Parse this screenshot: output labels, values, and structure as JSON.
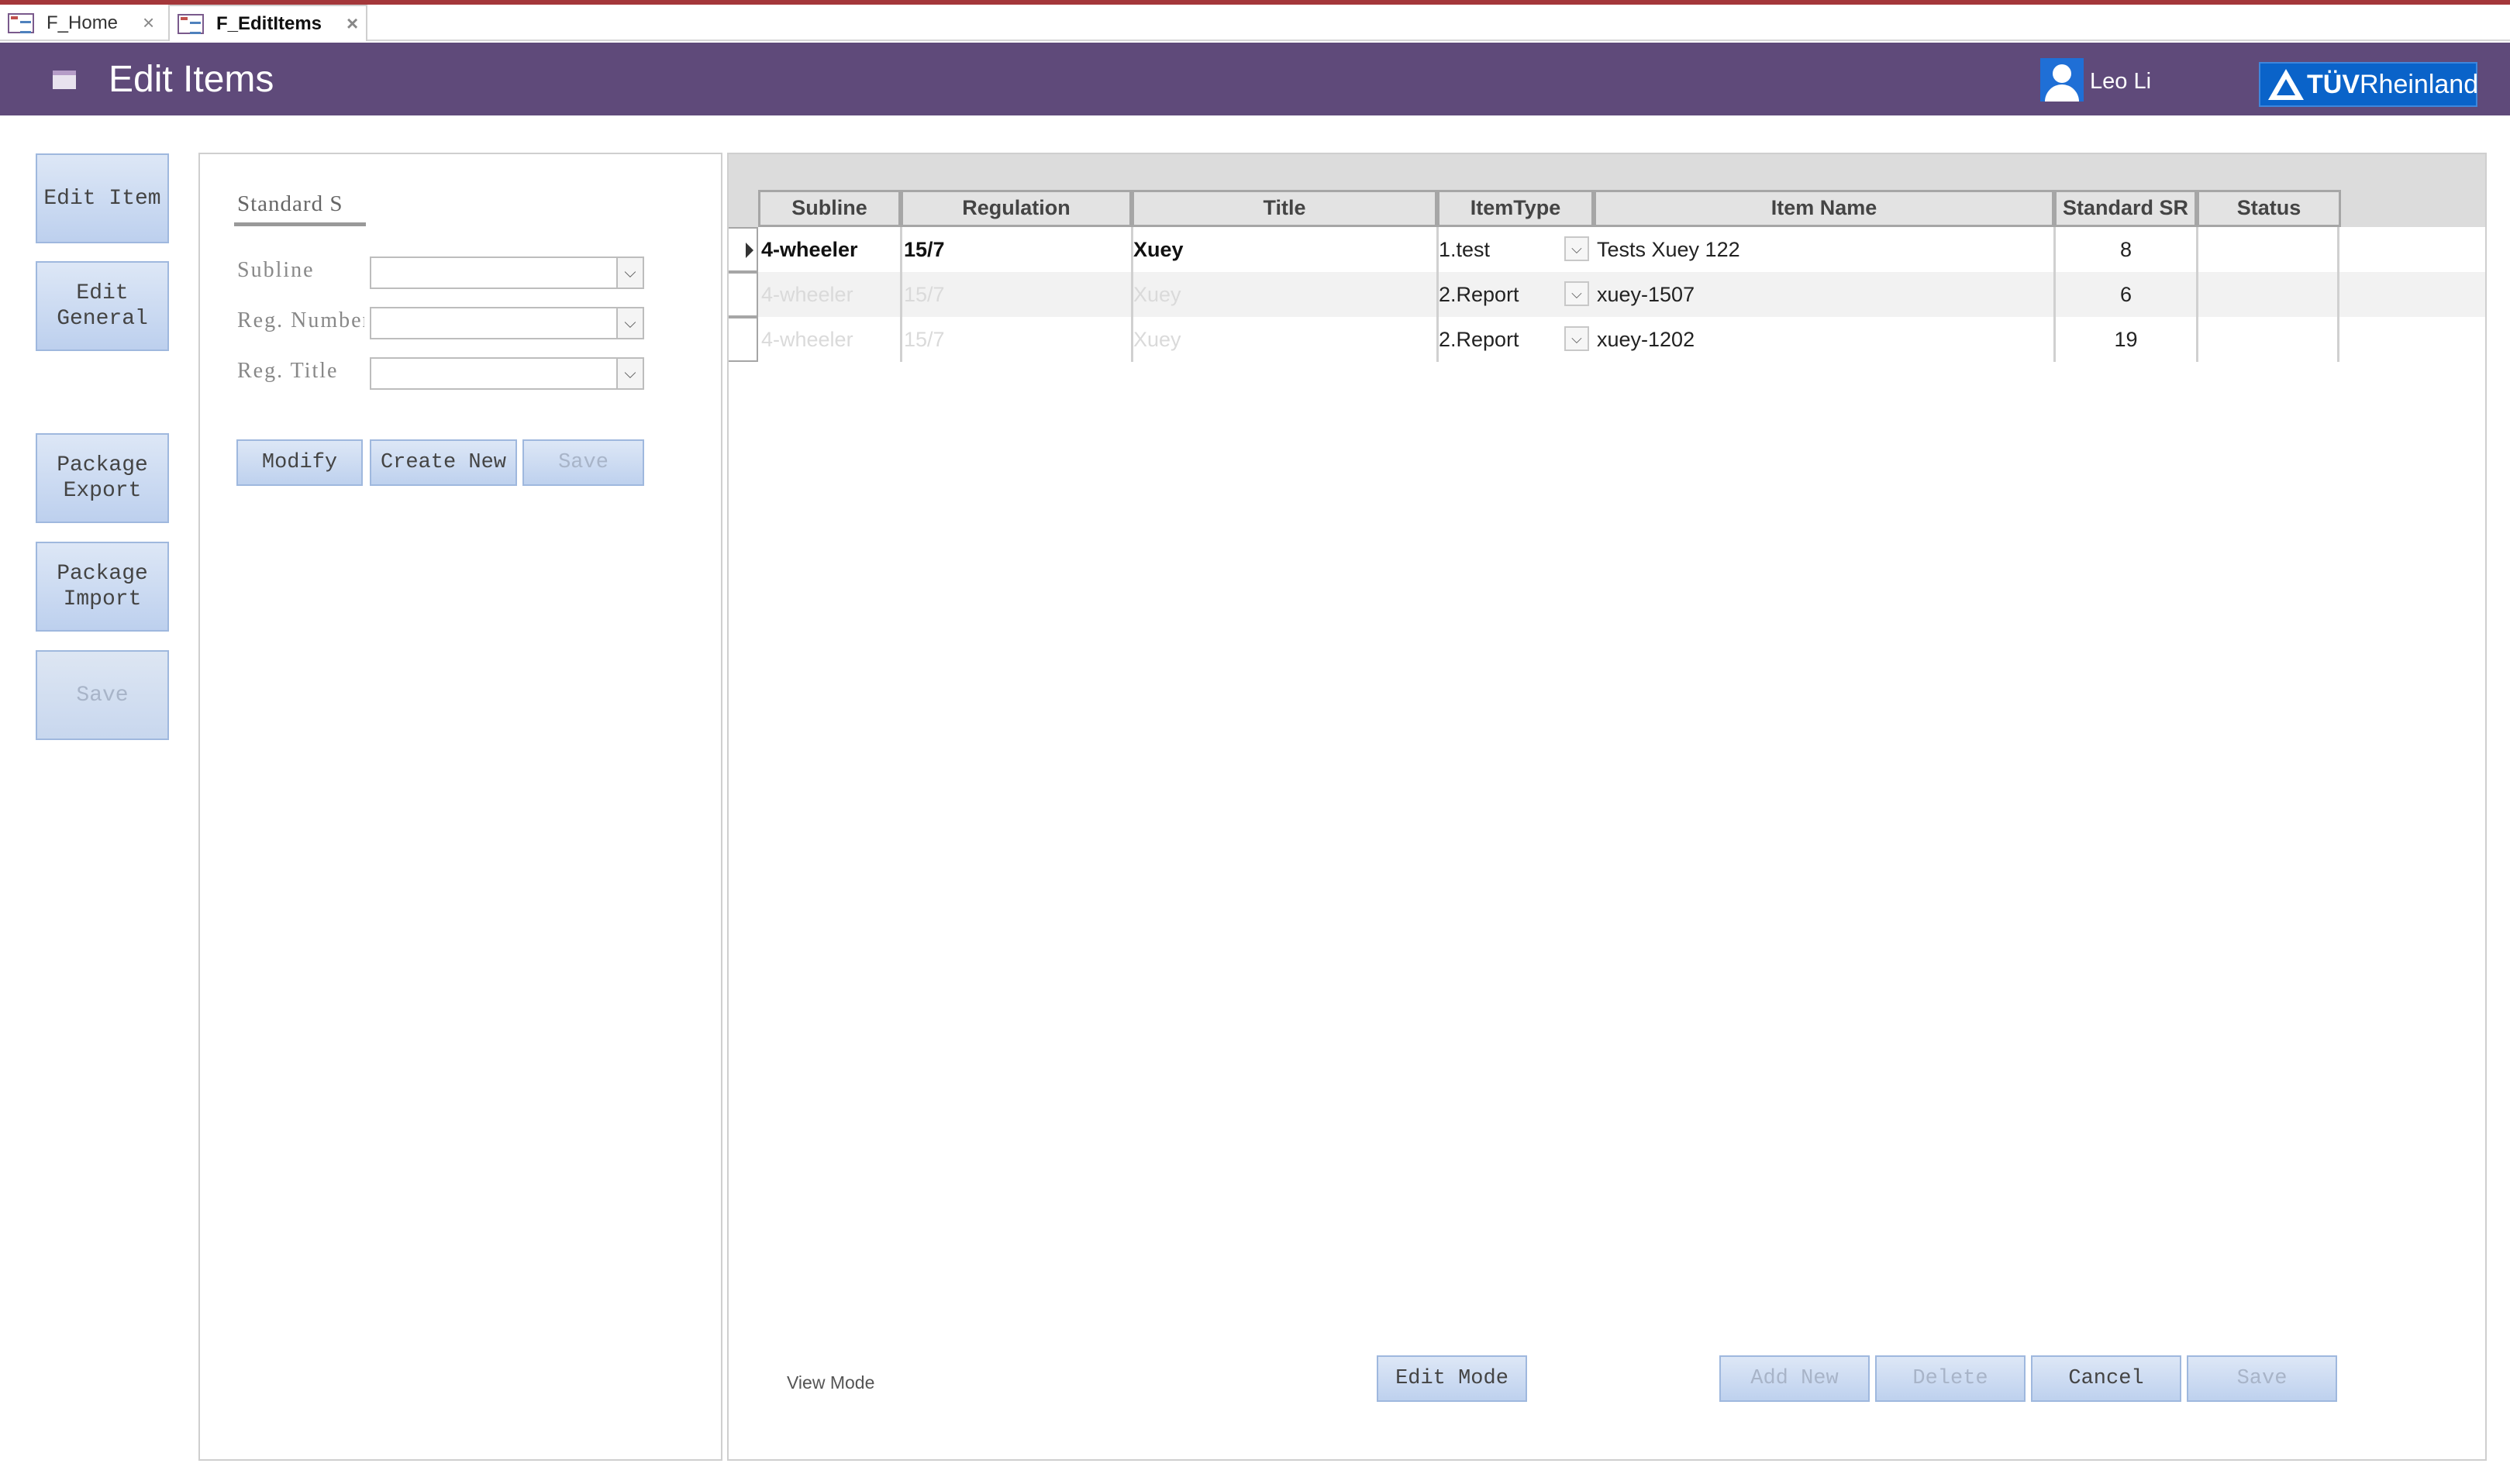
{
  "tabs": [
    {
      "label": "F_Home"
    },
    {
      "label": "F_EditItems"
    }
  ],
  "header": {
    "title": "Edit Items",
    "user_name": "Leo Li",
    "logo_tuv": "TÜV",
    "logo_rheinland": "Rheinland",
    "bg_color": "#5f4a7a"
  },
  "nav": {
    "edit_item": "Edit Item",
    "edit_general": "Edit\nGeneral",
    "package_export": "Package\nExport",
    "package_import": "Package\nImport",
    "save": "Save"
  },
  "filter": {
    "heading": "Standard S",
    "subline_label": "Subline",
    "subline_value": "",
    "reg_number_label": "Reg. Number",
    "reg_number_value": "",
    "reg_title_label": "Reg. Title",
    "reg_title_value": "",
    "modify": "Modify",
    "create_new": "Create New",
    "save": "Save"
  },
  "grid": {
    "columns": [
      "Subline",
      "Regulation",
      "Title",
      "ItemType",
      "Item Name",
      "Standard SR",
      "Status"
    ],
    "rows": [
      {
        "subline": "4-wheeler",
        "regulation": "15/7",
        "title": "Xuey",
        "item_type": "1.test",
        "item_name": "Tests Xuey 122",
        "standard_sr": "8",
        "status": ""
      },
      {
        "subline": "4-wheeler",
        "regulation": "15/7",
        "title": "Xuey",
        "item_type": "2.Report",
        "item_name": "xuey-1507",
        "standard_sr": "6",
        "status": ""
      },
      {
        "subline": "4-wheeler",
        "regulation": "15/7",
        "title": "Xuey",
        "item_type": "2.Report",
        "item_name": "xuey-1202",
        "standard_sr": "19",
        "status": ""
      }
    ]
  },
  "footer": {
    "view_mode": "View Mode",
    "edit_mode": "Edit Mode",
    "add_new": "Add New",
    "delete": "Delete",
    "cancel": "Cancel",
    "save": "Save"
  }
}
